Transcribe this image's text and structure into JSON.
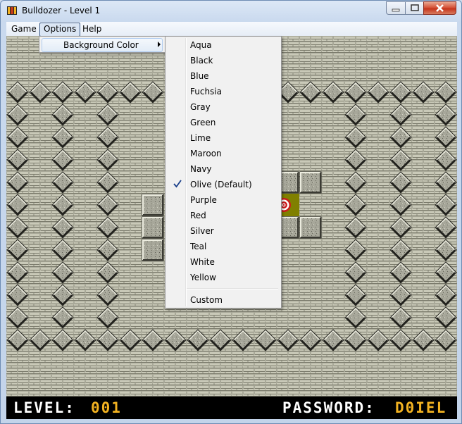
{
  "window": {
    "title": "Bulldozer - Level 1"
  },
  "menubar": {
    "game": "Game",
    "options": "Options",
    "help": "Help"
  },
  "options_menu": {
    "background_color": "Background Color"
  },
  "colors_submenu": {
    "items": [
      "Aqua",
      "Black",
      "Blue",
      "Fuchsia",
      "Gray",
      "Green",
      "Lime",
      "Maroon",
      "Navy",
      "Olive (Default)",
      "Purple",
      "Red",
      "Silver",
      "Teal",
      "White",
      "Yellow"
    ],
    "checked": "Olive (Default)",
    "custom": "Custom"
  },
  "status": {
    "level_label": "LEVEL:",
    "level_value": "001",
    "password_label": "PASSWORD:",
    "password_value": "D0IEL"
  },
  "theme": {
    "accent_yellow": "#f2b221",
    "target_red": "#cc1b1b",
    "olive": "#808000"
  }
}
